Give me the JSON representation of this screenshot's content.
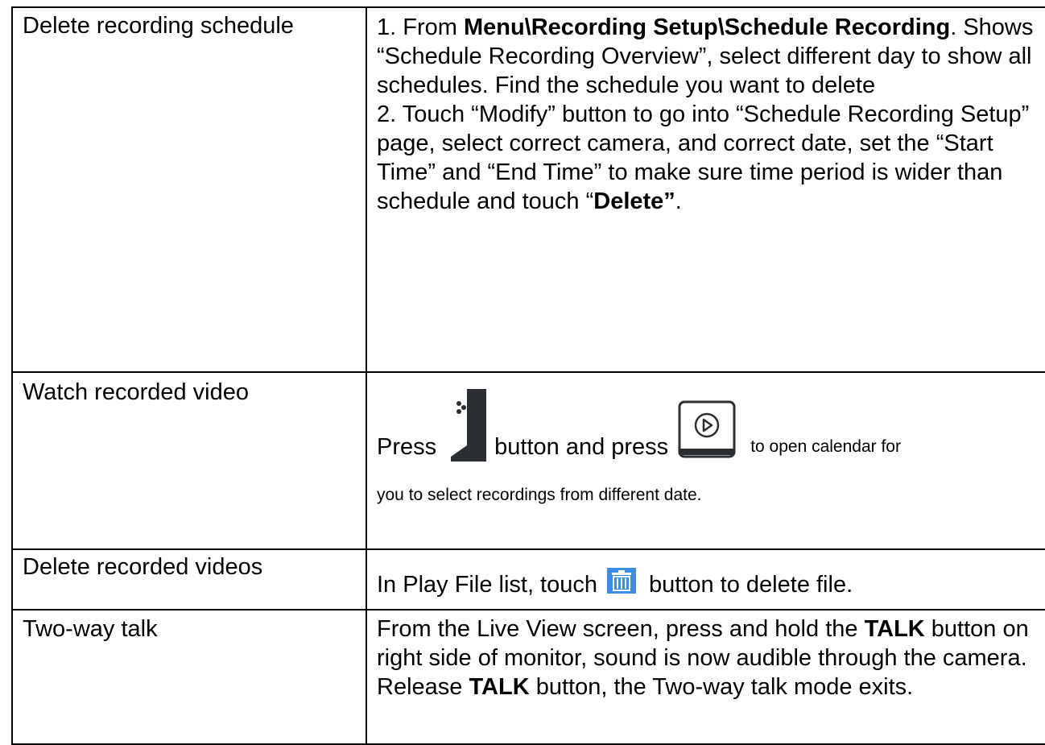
{
  "rows": {
    "delete_schedule": {
      "label": "Delete recording schedule",
      "step1_prefix": "1. From ",
      "step1_menu": "Menu\\Recording Setup\\Schedule Recording",
      "step1_rest": ". Shows “Schedule Recording Overview”, select different day to show all schedules. Find the schedule you want to delete",
      "step2_prefix": "2. Touch “Modify” button to go into “Schedule Recording Setup” page, select correct camera, and correct date, set the “Start Time” and “End Time” to make sure time period is wider than schedule and touch “",
      "step2_bold": "Delete”",
      "step2_end": "."
    },
    "watch_video": {
      "label": "Watch recorded video",
      "press": "Press",
      "button_and_press": "button and press",
      "to_open": "to open calendar for",
      "line2": "you to select recordings from different date."
    },
    "delete_videos": {
      "label": "Delete recorded videos",
      "prefix": "In Play File list, touch",
      "suffix": "button to delete file."
    },
    "two_way": {
      "label": "Two-way talk",
      "p1_prefix": "From the Live View screen, press and hold the ",
      "p1_bold": "TALK",
      "p1_rest": " button on right side of monitor, sound is now audible through the camera.",
      "p2_prefix": "Release ",
      "p2_bold": "TALK",
      "p2_rest": " button, the Two-way talk mode exits."
    }
  },
  "icons": {
    "monitor": "monitor-side-button-icon",
    "play": "play-circle-icon",
    "trash": "trash-icon",
    "trash_color": "#3b8fe8"
  }
}
